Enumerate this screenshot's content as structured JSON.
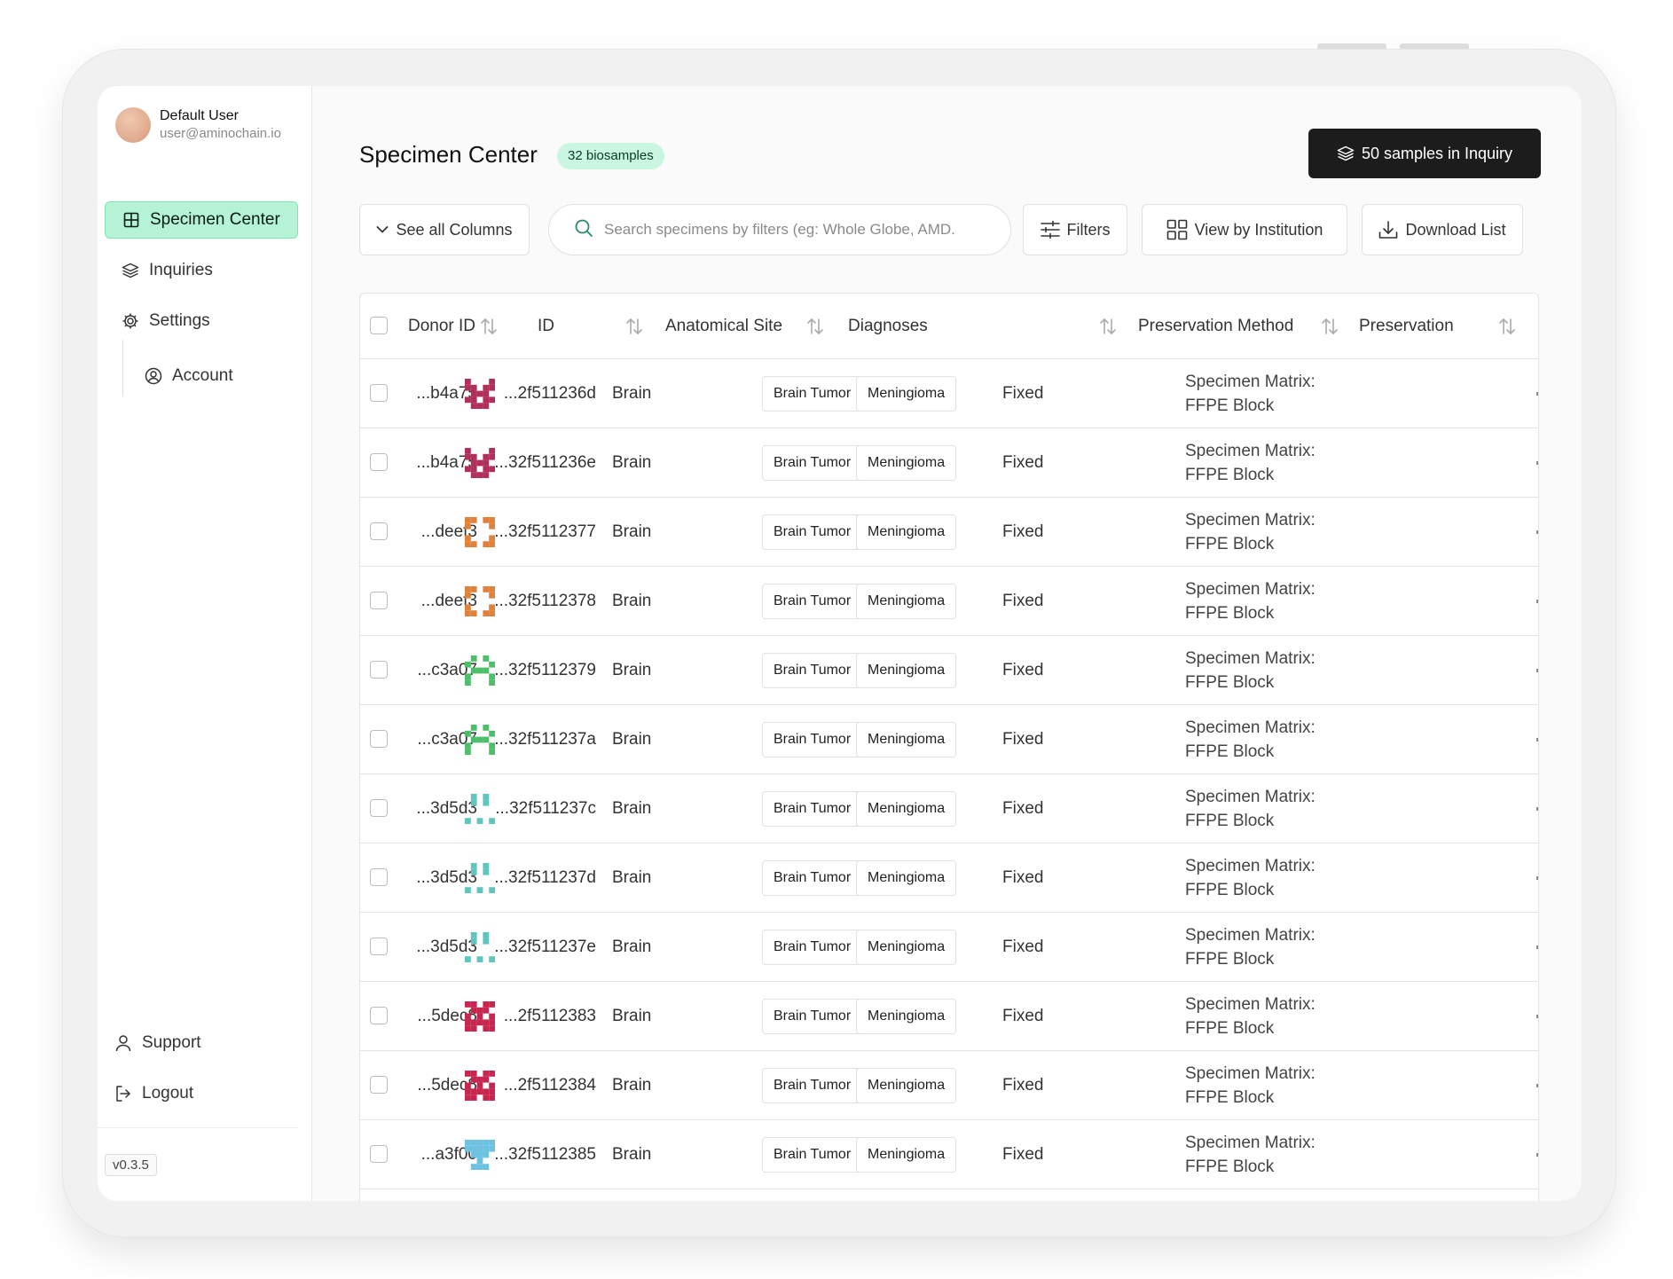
{
  "user": {
    "name": "Default User",
    "email": "user@aminochain.io"
  },
  "sidebar": {
    "items": [
      {
        "label": "Specimen Center",
        "icon": "grid-icon",
        "active": true
      },
      {
        "label": "Inquiries",
        "icon": "layers-icon"
      },
      {
        "label": "Settings",
        "icon": "gear-icon"
      },
      {
        "label": "Account",
        "icon": "user-circle-icon"
      }
    ],
    "bottom": [
      {
        "label": "Support",
        "icon": "user-icon"
      },
      {
        "label": "Logout",
        "icon": "logout-icon"
      }
    ],
    "version": "v0.3.5"
  },
  "header": {
    "title": "Specimen Center",
    "badge": "32 biosamples",
    "inquiry_button": "50 samples in Inquiry"
  },
  "toolbar": {
    "columns_label": "See all Columns",
    "search_placeholder": "Search specimens by filters (eg: Whole Globe, AMD.",
    "filters_label": "Filters",
    "institution_label": "View by Institution",
    "download_label": "Download List"
  },
  "table": {
    "columns": [
      "Donor ID",
      "ID",
      "Anatomical Site",
      "Diagnoses",
      "Preservation Method",
      "Preservation"
    ],
    "rows": [
      {
        "donor": "...b4a75",
        "id": "...2f511236d",
        "site": "Brain",
        "diag1": "Brain Tumor",
        "diag2": "Meningioma",
        "method": "Fixed",
        "pres1": "Specimen Matrix:",
        "pres2": "FFPE Block",
        "color": "#b0305a",
        "pattern": "a"
      },
      {
        "donor": "...b4a75",
        "id": "...32f511236e",
        "site": "Brain",
        "diag1": "Brain Tumor",
        "diag2": "Meningioma",
        "method": "Fixed",
        "pres1": "Specimen Matrix:",
        "pres2": "FFPE Block",
        "color": "#b0305a",
        "pattern": "a"
      },
      {
        "donor": "...deef3",
        "id": "...32f5112377",
        "site": "Brain",
        "diag1": "Brain Tumor",
        "diag2": "Meningioma",
        "method": "Fixed",
        "pres1": "Specimen Matrix:",
        "pres2": "FFPE Block",
        "color": "#e0823a",
        "pattern": "b"
      },
      {
        "donor": "...deef3",
        "id": "...32f5112378",
        "site": "Brain",
        "diag1": "Brain Tumor",
        "diag2": "Meningioma",
        "method": "Fixed",
        "pres1": "Specimen Matrix:",
        "pres2": "FFPE Block",
        "color": "#e0823a",
        "pattern": "b"
      },
      {
        "donor": "...c3a07",
        "id": "...32f5112379",
        "site": "Brain",
        "diag1": "Brain Tumor",
        "diag2": "Meningioma",
        "method": "Fixed",
        "pres1": "Specimen Matrix:",
        "pres2": "FFPE Block",
        "color": "#4cbf6a",
        "pattern": "c"
      },
      {
        "donor": "...c3a07",
        "id": "...32f511237a",
        "site": "Brain",
        "diag1": "Brain Tumor",
        "diag2": "Meningioma",
        "method": "Fixed",
        "pres1": "Specimen Matrix:",
        "pres2": "FFPE Block",
        "color": "#4cbf6a",
        "pattern": "c"
      },
      {
        "donor": "...3d5d3",
        "id": "...32f511237c",
        "site": "Brain",
        "diag1": "Brain Tumor",
        "diag2": "Meningioma",
        "method": "Fixed",
        "pres1": "Specimen Matrix:",
        "pres2": "FFPE Block",
        "color": "#5fc6bf",
        "pattern": "d"
      },
      {
        "donor": "...3d5d3",
        "id": "...32f511237d",
        "site": "Brain",
        "diag1": "Brain Tumor",
        "diag2": "Meningioma",
        "method": "Fixed",
        "pres1": "Specimen Matrix:",
        "pres2": "FFPE Block",
        "color": "#5fc6bf",
        "pattern": "d"
      },
      {
        "donor": "...3d5d3",
        "id": "...32f511237e",
        "site": "Brain",
        "diag1": "Brain Tumor",
        "diag2": "Meningioma",
        "method": "Fixed",
        "pres1": "Specimen Matrix:",
        "pres2": "FFPE Block",
        "color": "#5fc6bf",
        "pattern": "d"
      },
      {
        "donor": "...5dec8",
        "id": "...2f5112383",
        "site": "Brain",
        "diag1": "Brain Tumor",
        "diag2": "Meningioma",
        "method": "Fixed",
        "pres1": "Specimen Matrix:",
        "pres2": "FFPE Block",
        "color": "#c8264e",
        "pattern": "e"
      },
      {
        "donor": "...5dec8",
        "id": "...2f5112384",
        "site": "Brain",
        "diag1": "Brain Tumor",
        "diag2": "Meningioma",
        "method": "Fixed",
        "pres1": "Specimen Matrix:",
        "pres2": "FFPE Block",
        "color": "#c8264e",
        "pattern": "e"
      },
      {
        "donor": "...a3f00",
        "id": "...32f5112385",
        "site": "Brain",
        "diag1": "Brain Tumor",
        "diag2": "Meningioma",
        "method": "Fixed",
        "pres1": "Specimen Matrix:",
        "pres2": "FFPE Block",
        "color": "#6cc2e0",
        "pattern": "f"
      }
    ]
  }
}
